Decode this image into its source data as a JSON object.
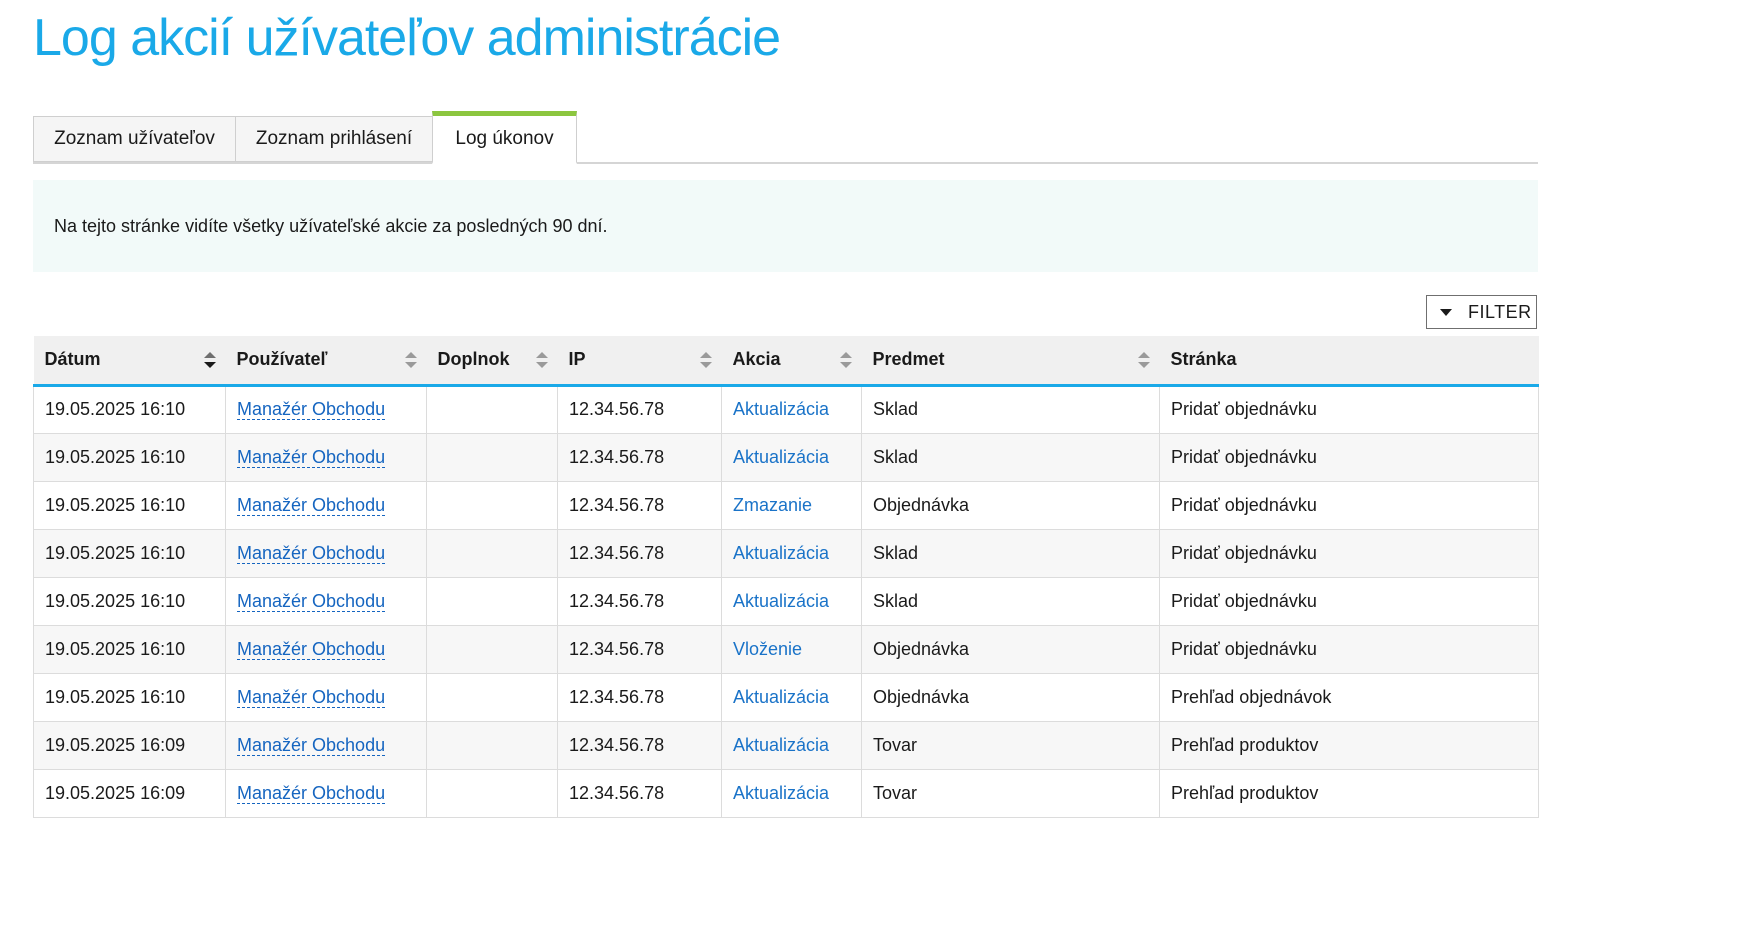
{
  "page": {
    "title": "Log akcií užívateľov administrácie"
  },
  "tabs": [
    {
      "label": "Zoznam užívateľov",
      "active": false
    },
    {
      "label": "Zoznam prihlásení",
      "active": false
    },
    {
      "label": "Log úkonov",
      "active": true
    }
  ],
  "info": {
    "text": "Na tejto stránke vidíte všetky užívateľské akcie za posledných 90 dní."
  },
  "filter": {
    "label": "FILTER",
    "icon": "caret-down-icon"
  },
  "table": {
    "columns": [
      "Dátum",
      "Používateľ",
      "Doplnok",
      "IP",
      "Akcia",
      "Predmet",
      "Stránka"
    ],
    "sorted_column": "Dátum",
    "sort_direction": "desc",
    "rows": [
      {
        "date": "19.05.2025 16:10",
        "user": "Manažér Obchodu",
        "addon": "",
        "ip": "12.34.56.78",
        "action": "Aktualizácia",
        "subject": "Sklad",
        "page": "Pridať objednávku"
      },
      {
        "date": "19.05.2025 16:10",
        "user": "Manažér Obchodu",
        "addon": "",
        "ip": "12.34.56.78",
        "action": "Aktualizácia",
        "subject": "Sklad",
        "page": "Pridať objednávku"
      },
      {
        "date": "19.05.2025 16:10",
        "user": "Manažér Obchodu",
        "addon": "",
        "ip": "12.34.56.78",
        "action": "Zmazanie",
        "subject": "Objednávka",
        "page": "Pridať objednávku"
      },
      {
        "date": "19.05.2025 16:10",
        "user": "Manažér Obchodu",
        "addon": "",
        "ip": "12.34.56.78",
        "action": "Aktualizácia",
        "subject": "Sklad",
        "page": "Pridať objednávku"
      },
      {
        "date": "19.05.2025 16:10",
        "user": "Manažér Obchodu",
        "addon": "",
        "ip": "12.34.56.78",
        "action": "Aktualizácia",
        "subject": "Sklad",
        "page": "Pridať objednávku"
      },
      {
        "date": "19.05.2025 16:10",
        "user": "Manažér Obchodu",
        "addon": "",
        "ip": "12.34.56.78",
        "action": "Vloženie",
        "subject": "Objednávka",
        "page": "Pridať objednávku"
      },
      {
        "date": "19.05.2025 16:10",
        "user": "Manažér Obchodu",
        "addon": "",
        "ip": "12.34.56.78",
        "action": "Aktualizácia",
        "subject": "Objednávka",
        "page": "Prehľad objednávok"
      },
      {
        "date": "19.05.2025 16:09",
        "user": "Manažér Obchodu",
        "addon": "",
        "ip": "12.34.56.78",
        "action": "Aktualizácia",
        "subject": "Tovar",
        "page": "Prehľad produktov"
      },
      {
        "date": "19.05.2025 16:09",
        "user": "Manažér Obchodu",
        "addon": "",
        "ip": "12.34.56.78",
        "action": "Aktualizácia",
        "subject": "Tovar",
        "page": "Prehľad produktov"
      }
    ]
  },
  "colors": {
    "title": "#1aa9e8",
    "active_tab_accent": "#8cc63f",
    "header_underline": "#1aa9e8",
    "link": "#1565c0",
    "info_background": "#f2faf9"
  }
}
